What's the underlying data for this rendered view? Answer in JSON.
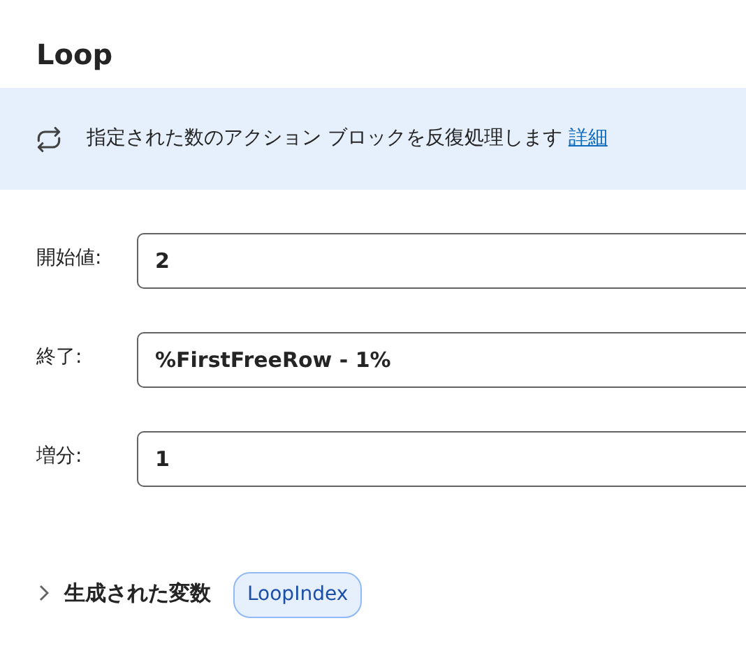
{
  "title": "Loop",
  "info": {
    "text": "指定された数のアクション ブロックを反復処理します",
    "link": "詳細"
  },
  "fields": [
    {
      "label": "開始値:",
      "value": "2"
    },
    {
      "label": "終了:",
      "value": "%FirstFreeRow - 1%"
    },
    {
      "label": "増分:",
      "value": "1"
    }
  ],
  "variables": {
    "label": "生成された変数",
    "expanded": false,
    "items": [
      "LoopIndex"
    ]
  }
}
